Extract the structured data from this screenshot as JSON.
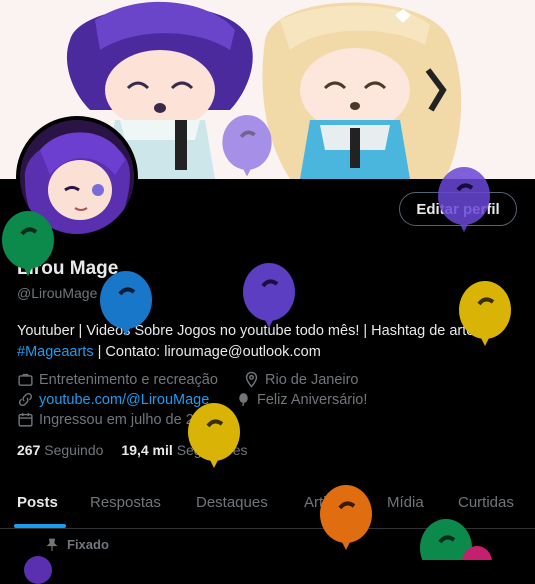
{
  "profile": {
    "name": "Lirou Mage",
    "handle": "@LirouMage",
    "edit_button": "Editar perfil",
    "bio_line1": "Youtuber | Videos Sobre Jogos no youtube todo mês! | Hashtag de artes:",
    "bio_hashtag": "#Mageaarts",
    "bio_contact": " | Contato: liroumage@outlook.com",
    "category": "Entretenimento e recreação",
    "location": "Rio de Janeiro",
    "website": "youtube.com/@LirouMage",
    "birthday": "Feliz Aniversário!",
    "joined": "Ingressou em julho de 2021",
    "following_count": "267",
    "following_label": "Seguindo",
    "followers_count": "19,4 mil",
    "followers_label": "Seguidores"
  },
  "tabs": [
    "Posts",
    "Respostas",
    "Destaques",
    "Artigos",
    "Mídia",
    "Curtidas"
  ],
  "active_tab": "Posts",
  "pinned_label": "Fixado",
  "colors": {
    "accent": "#1d9bf0",
    "balloon_green": "#0b8a4c",
    "balloon_blue": "#1877c9",
    "balloon_purple": "#5b3ec2",
    "balloon_gold": "#d9b305",
    "balloon_orange": "#e06d10"
  },
  "icons": [
    "briefcase-icon",
    "location-pin-icon",
    "link-icon",
    "balloon-icon",
    "calendar-icon",
    "pin-icon"
  ]
}
